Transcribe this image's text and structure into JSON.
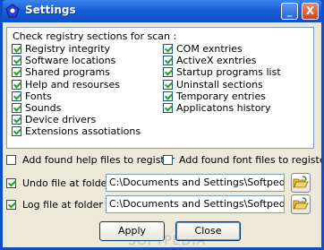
{
  "window": {
    "title": "Settings",
    "minimize_label": "_",
    "close_label": "X"
  },
  "registry": {
    "label": "Check registry sections for scan :",
    "left_items": [
      {
        "label": "Registry integrity",
        "checked": true
      },
      {
        "label": "Software locations",
        "checked": true
      },
      {
        "label": "Shared programs",
        "checked": true
      },
      {
        "label": "Help and resourses",
        "checked": true
      },
      {
        "label": "Fonts",
        "checked": true
      },
      {
        "label": "Sounds",
        "checked": true
      },
      {
        "label": "Device drivers",
        "checked": true
      },
      {
        "label": "Extensions assotiations",
        "checked": true
      }
    ],
    "right_items": [
      {
        "label": "COM exntries",
        "checked": true
      },
      {
        "label": "ActiveX exntries",
        "checked": true
      },
      {
        "label": "Startup programs list",
        "checked": true
      },
      {
        "label": "Uninstall sections",
        "checked": true
      },
      {
        "label": "Temporary entries",
        "checked": true
      },
      {
        "label": "Applicatons history",
        "checked": true
      }
    ]
  },
  "options": {
    "add_help_label": "Add found help files to register",
    "add_help_checked": false,
    "add_font_label": "Add found font files to register",
    "add_font_checked": false,
    "undo_label": "Undo file at folder",
    "undo_checked": true,
    "undo_path": "C:\\Documents and Settings\\Softpedia\\D",
    "log_label": "Log file at folder",
    "log_checked": true,
    "log_path": "C:\\Documents and Settings\\Softpedia\\D"
  },
  "buttons": {
    "apply": "Apply",
    "close": "Close"
  },
  "watermark": "SOFTPEDIA"
}
